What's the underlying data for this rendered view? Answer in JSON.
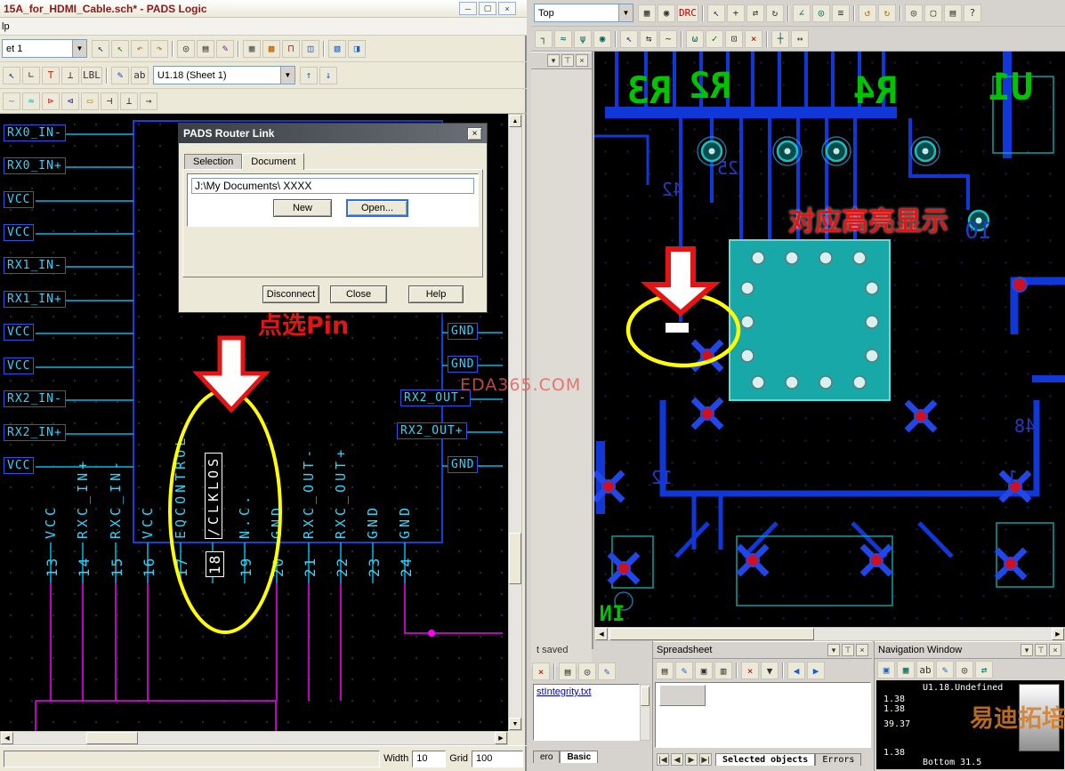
{
  "window": {
    "title": "15A_for_HDMI_Cable.sch* - PADS Logic",
    "menu": "lp",
    "sheet_combo": "et 1",
    "selection_combo": "U1.18 (Sheet 1)"
  },
  "glyphs": {
    "up": "▲",
    "down": "▼",
    "left": "◀",
    "right": "▶",
    "combo": "▼"
  },
  "titlebar_icons": [
    {
      "n": "minimize",
      "g": "─",
      "c": "#333"
    },
    {
      "n": "restore",
      "g": "▢",
      "c": "#333"
    },
    {
      "n": "close",
      "g": "×",
      "c": "#333"
    }
  ],
  "toolbars": {
    "panel_header": [
      {
        "n": "chevron-down",
        "g": "▾",
        "c": "#333"
      },
      {
        "n": "pin",
        "g": "⊤",
        "c": "#333"
      },
      {
        "n": "close",
        "g": "×",
        "c": "#333"
      }
    ],
    "left1": [
      {
        "n": "select",
        "g": "↖",
        "c": "#14327c"
      },
      {
        "n": "copy-mode",
        "g": "↖",
        "c": "#2e7d1f"
      },
      {
        "n": "undo",
        "g": "↶",
        "c": "#b07010"
      },
      {
        "n": "redo",
        "g": "↷",
        "c": "#b07010"
      },
      {
        "n": "sep"
      },
      {
        "n": "zoom",
        "g": "◎",
        "c": "#333"
      },
      {
        "n": "sheet",
        "g": "▤",
        "c": "#333"
      },
      {
        "n": "brush",
        "g": "✎",
        "c": "#7a1fa0"
      },
      {
        "n": "sep"
      },
      {
        "n": "grid",
        "g": "▦",
        "c": "#555"
      },
      {
        "n": "bitmap",
        "g": "▩",
        "c": "#c06000"
      },
      {
        "n": "gate",
        "g": "⊓",
        "c": "#aa2222"
      },
      {
        "n": "part",
        "g": "◫",
        "c": "#2244aa"
      },
      {
        "n": "sep"
      },
      {
        "n": "plot",
        "g": "▧",
        "c": "#1560d4"
      },
      {
        "n": "preview",
        "g": "◨",
        "c": "#1560d4"
      }
    ],
    "left2a": [
      {
        "n": "select-mode",
        "g": "↖",
        "c": "#14327c"
      },
      {
        "n": "connection",
        "g": "∟",
        "c": "#333"
      },
      {
        "n": "text",
        "g": "T",
        "c": "#cc2200"
      },
      {
        "n": "ground",
        "g": "⊥",
        "c": "#333"
      },
      {
        "n": "label",
        "g": "LBL",
        "c": "#333"
      },
      {
        "n": "sep"
      },
      {
        "n": "pen",
        "g": "✎",
        "c": "#2244cc"
      },
      {
        "n": "ab-text",
        "g": "ab",
        "c": "#333"
      }
    ],
    "left2b": [
      {
        "n": "previous-gate",
        "g": "↑",
        "c": "#1560d4"
      },
      {
        "n": "next-gate",
        "g": "↓",
        "c": "#1560d4"
      }
    ],
    "left3": [
      {
        "n": "wire",
        "g": "~",
        "c": "#22aaaa"
      },
      {
        "n": "bus",
        "g": "≈",
        "c": "#22aaaa"
      },
      {
        "n": "gate-red",
        "g": "⊳",
        "c": "#cc2222"
      },
      {
        "n": "gate-blue",
        "g": "⊲",
        "c": "#2222cc"
      },
      {
        "n": "resistor",
        "g": "▭",
        "c": "#b8860b"
      },
      {
        "n": "capacitor",
        "g": "⊣",
        "c": "#333"
      },
      {
        "n": "ground2",
        "g": "⊥",
        "c": "#333"
      },
      {
        "n": "offpage",
        "g": "→",
        "c": "#333"
      }
    ],
    "right1": [
      {
        "n": "grid",
        "g": "▦",
        "c": "#333"
      },
      {
        "n": "origin",
        "g": "◉",
        "c": "#333"
      },
      {
        "n": "drc",
        "g": "DRC",
        "c": "#c00000"
      },
      {
        "n": "sep"
      },
      {
        "n": "pointer",
        "g": "↖",
        "c": "#14327c"
      },
      {
        "n": "pan",
        "g": "+",
        "c": "#333"
      },
      {
        "n": "move",
        "g": "⇄",
        "c": "#333"
      },
      {
        "n": "rotate",
        "g": "↻",
        "c": "#333"
      },
      {
        "n": "sep"
      },
      {
        "n": "measure",
        "g": "∠",
        "c": "#066"
      },
      {
        "n": "via",
        "g": "◎",
        "c": "#066"
      },
      {
        "n": "layers",
        "g": "≡",
        "c": "#333"
      },
      {
        "n": "sep"
      },
      {
        "n": "undo",
        "g": "↺",
        "c": "#b07010"
      },
      {
        "n": "redo",
        "g": "↻",
        "c": "#b07010"
      },
      {
        "n": "sep"
      },
      {
        "n": "zoom-in",
        "g": "◎",
        "c": "#333"
      },
      {
        "n": "fit",
        "g": "▢",
        "c": "#333"
      },
      {
        "n": "report",
        "g": "▤",
        "c": "#333"
      },
      {
        "n": "help",
        "g": "?",
        "c": "#333"
      }
    ],
    "right2": [
      {
        "n": "route",
        "g": "┐",
        "c": "#066"
      },
      {
        "n": "autoroute",
        "g": "≈",
        "c": "#066"
      },
      {
        "n": "fanout",
        "g": "ψ",
        "c": "#066"
      },
      {
        "n": "add-via",
        "g": "◉",
        "c": "#066"
      },
      {
        "n": "sep"
      },
      {
        "n": "select",
        "g": "↖",
        "c": "#14327c"
      },
      {
        "n": "align",
        "g": "⇆",
        "c": "#333"
      },
      {
        "n": "jog",
        "g": "~",
        "c": "#333"
      },
      {
        "n": "sep"
      },
      {
        "n": "tune",
        "g": "ω",
        "c": "#066"
      },
      {
        "n": "verify",
        "g": "✓",
        "c": "#007700"
      },
      {
        "n": "protect",
        "g": "⊡",
        "c": "#333"
      },
      {
        "n": "unroute",
        "g": "×",
        "c": "#c00000"
      },
      {
        "n": "sep"
      },
      {
        "n": "bus-route",
        "g": "┼",
        "c": "#066"
      },
      {
        "n": "spread",
        "g": "↔",
        "c": "#333"
      }
    ],
    "spreadsheet": [
      {
        "n": "properties",
        "g": "▤",
        "c": "#333"
      },
      {
        "n": "style",
        "g": "✎",
        "c": "#2266cc"
      },
      {
        "n": "copy",
        "g": "▣",
        "c": "#333"
      },
      {
        "n": "paste",
        "g": "▥",
        "c": "#333"
      },
      {
        "n": "sep"
      },
      {
        "n": "delete",
        "g": "×",
        "c": "#c00000"
      },
      {
        "n": "filter",
        "g": "▼",
        "c": "#333"
      },
      {
        "n": "sep"
      },
      {
        "n": "prev",
        "g": "◀",
        "c": "#1560d4"
      },
      {
        "n": "next",
        "g": "▶",
        "c": "#1560d4"
      }
    ],
    "navigation": [
      {
        "n": "select-nav",
        "g": "▣",
        "c": "#2266cc"
      },
      {
        "n": "board",
        "g": "▦",
        "c": "#066"
      },
      {
        "n": "ab-text",
        "g": "ab",
        "c": "#333"
      },
      {
        "n": "draw",
        "g": "✎",
        "c": "#2266cc"
      },
      {
        "n": "zoom-nav",
        "g": "◎",
        "c": "#333"
      },
      {
        "n": "sync",
        "g": "⇄",
        "c": "#066"
      }
    ],
    "output": [
      {
        "n": "clear",
        "g": "×",
        "c": "#c00000"
      },
      {
        "n": "sep"
      },
      {
        "n": "print",
        "g": "▤",
        "c": "#333"
      },
      {
        "n": "find",
        "g": "◎",
        "c": "#333"
      },
      {
        "n": "edit",
        "g": "✎",
        "c": "#2266cc"
      }
    ],
    "vcr": [
      {
        "n": "first-record",
        "g": "|◀",
        "c": "#333"
      },
      {
        "n": "prev-record",
        "g": "◀",
        "c": "#333"
      },
      {
        "n": "next-record",
        "g": "▶",
        "c": "#333"
      },
      {
        "n": "last-record",
        "g": "▶|",
        "c": "#333"
      }
    ]
  },
  "dialog": {
    "title": "PADS Router Link",
    "tabs": [
      "Selection",
      "Document"
    ],
    "path": "J:\\My Documents\\ XXXX",
    "new": "New",
    "open": "Open...",
    "disconnect": "Disconnect",
    "close": "Close",
    "help": "Help"
  },
  "schematic": {
    "left_labels": [
      "RX0_IN-",
      "RX0_IN+",
      "VCC",
      "VCC",
      "RX1_IN-",
      "RX1_IN+",
      "VCC",
      "VCC",
      "RX2_IN-",
      "RX2_IN+",
      "VCC"
    ],
    "right_labels": [
      "GND",
      "GND",
      "RX2_OUT-",
      "RX2_OUT+",
      "GND"
    ],
    "pin_names": [
      "VCC",
      "RXC_IN+",
      "RXC_IN-",
      "VCC",
      "EQCONTROL",
      "/CLKLOS",
      "N.C.",
      "GND",
      "RXC_OUT-",
      "RXC_OUT+",
      "GND",
      "GND"
    ],
    "pin_numbers": [
      "13",
      "14",
      "15",
      "16",
      "17",
      "18",
      "19",
      "20",
      "21",
      "22",
      "23",
      "24"
    ]
  },
  "router": {
    "layer_combo": "Top",
    "silkscreen": [
      "R3",
      "R2",
      "R4",
      "U1",
      "IN"
    ],
    "numbers": [
      "42",
      "25",
      "10",
      "12",
      "48",
      "1"
    ]
  },
  "annotations": {
    "pick_pin": "点选Pin",
    "highlight": "对应高亮显示",
    "watermark_eda": "EDA365.COM",
    "watermark_brand": "易迪拓培训",
    "colors": {
      "annotation_red": "#e41414",
      "highlight_yellow": "#ffff00"
    }
  },
  "status": {
    "width_label": "Width",
    "width_value": "10",
    "grid_label": "Grid",
    "grid_value": "100"
  },
  "panels": {
    "output": {
      "line": "t saved",
      "link": "stIntegrity.txt",
      "tabs": [
        "ero",
        "Basic"
      ]
    },
    "spreadsheet": {
      "title": "Spreadsheet",
      "tabs": [
        "Selected objects",
        "Errors"
      ]
    },
    "navigation": {
      "title": "Navigation Window",
      "header": "U1.18.Undefined",
      "values": [
        "1.38",
        "1.38",
        "39.37",
        "1.38"
      ],
      "footer": "Bottom 31.5"
    }
  }
}
